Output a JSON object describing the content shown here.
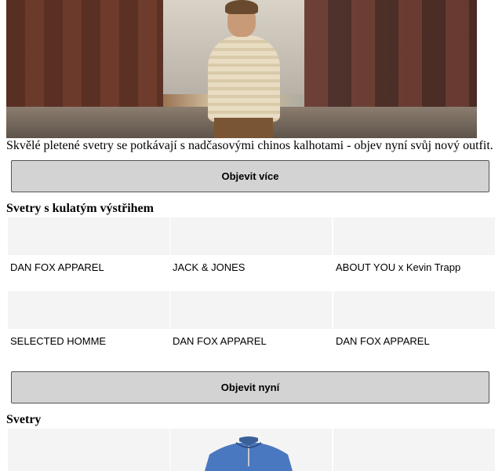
{
  "hero": {
    "image_name": "man-in-cable-knit-sweater-photo"
  },
  "caption": "Skvělé pletené svetry se potkávají s nadčasovými chinos kalhotami - objev nyní svůj nový outfit.",
  "buttons": {
    "explore_more": "Objevit více",
    "explore_now": "Objevit nyní"
  },
  "sections": {
    "crew_neck": {
      "title": "Svetry s kulatým výstřihem",
      "brands": [
        "DAN FOX APPAREL",
        "JACK & JONES",
        "ABOUT YOU x Kevin Trapp",
        "SELECTED HOMME",
        "DAN FOX APPAREL",
        "DAN FOX APPAREL"
      ]
    },
    "sweaters": {
      "title": "Svetry"
    }
  },
  "colors": {
    "button_bg": "#d3d3d3",
    "tile_bg": "#f4f4f4",
    "sweater_blue": "#4a78c0"
  }
}
